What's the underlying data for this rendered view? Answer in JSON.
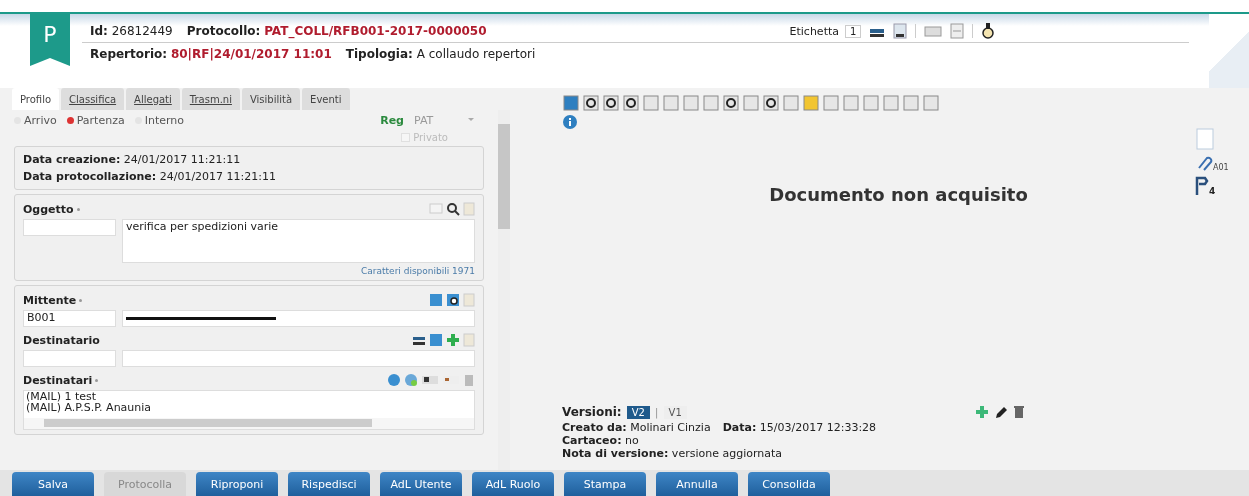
{
  "header": {
    "logo_letter": "P",
    "id_label": "Id:",
    "id": "26812449",
    "protocollo_label": "Protocollo:",
    "protocollo": "PAT_COLL/RFB001-2017-0000050",
    "repertorio_label": "Repertorio:",
    "repertorio": "80|RF|24/01/2017 11:01",
    "tipologia_label": "Tipologia:",
    "tipologia": "A collaudo repertori",
    "etichetta_label": "Etichetta",
    "etichetta_count": "1"
  },
  "tabs": [
    {
      "label": "Profilo",
      "selected": true
    },
    {
      "label": "Classifica",
      "selected": false
    },
    {
      "label": "Allegati",
      "selected": false
    },
    {
      "label": "Trasm.ni",
      "selected": false
    },
    {
      "label": "Visibilità",
      "selected": false
    },
    {
      "label": "Eventi",
      "selected": false
    }
  ],
  "direction": [
    {
      "label": "Arrivo",
      "selected": false
    },
    {
      "label": "Partenza",
      "selected": true
    },
    {
      "label": "Interno",
      "selected": false
    }
  ],
  "reg": {
    "label": "Reg",
    "value": "PAT"
  },
  "privato": {
    "label": "Privato",
    "checked": false,
    "disabled": true
  },
  "dates": [
    {
      "label": "Data creazione:",
      "value": "24/01/2017 11:21:11"
    },
    {
      "label": "Data protocollazione:",
      "value": "24/01/2017 11:21:11"
    }
  ],
  "oggetto": {
    "label": "Oggetto",
    "required": true,
    "text": "verifica per spedizioni varie",
    "counter": "Caratteri disponibili 1971"
  },
  "mittente": {
    "label": "Mittente",
    "required": true,
    "code": "B001"
  },
  "destinatario": {
    "label": "Destinatario"
  },
  "destinatari": {
    "label": "Destinatari",
    "required": true,
    "items": [
      "(MAIL) 1 test",
      "(MAIL) A.P.S.P. Anaunia"
    ]
  },
  "viewer": {
    "message": "Documento non acquisito"
  },
  "versions": {
    "label": "Versioni:",
    "separator": "|",
    "items": [
      {
        "label": "V2",
        "selected": true
      },
      {
        "label": "V1",
        "selected": false
      }
    ],
    "details": [
      [
        {
          "label": "Creato da:",
          "value": "Molinari Cinzia"
        },
        {
          "label": "Data:",
          "value": "15/03/2017 12:33:28"
        }
      ],
      [
        {
          "label": "Cartaceo:",
          "value": "no"
        }
      ],
      [
        {
          "label": "Nota di versione:",
          "value": "versione aggiornata"
        }
      ]
    ]
  },
  "side": {
    "attachment": "A01",
    "badge": "4"
  },
  "buttons": [
    {
      "label": "Salva",
      "disabled": false
    },
    {
      "label": "Protocolla",
      "disabled": true
    },
    {
      "label": "Riproponi",
      "disabled": false
    },
    {
      "label": "Rispedisci",
      "disabled": false
    },
    {
      "label": "AdL Utente",
      "disabled": false
    },
    {
      "label": "AdL Ruolo",
      "disabled": false
    },
    {
      "label": "Stampa",
      "disabled": false
    },
    {
      "label": "Annulla",
      "disabled": false
    },
    {
      "label": "Consolida",
      "disabled": false
    }
  ]
}
